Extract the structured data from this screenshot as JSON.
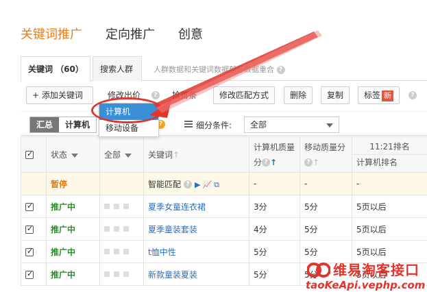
{
  "topnav": [
    "关键词推广",
    "定向推广",
    "创意"
  ],
  "tabs": {
    "keywords": "关键词 （60）",
    "audience": "搜索人群",
    "note": "人群数据和关键词数据部分数据重合"
  },
  "toolbar": {
    "add_keyword": "+ 添加关键词",
    "modify_bid": "修改出价",
    "first_strip": "抢首条",
    "modify_match": "修改匹配方式",
    "delete": "删除",
    "copy": "复制",
    "label": "标签",
    "label_badge": "新"
  },
  "dropdown": {
    "options": [
      "计算机",
      "移动设备"
    ]
  },
  "filterbar": {
    "summary": "汇总",
    "computer": "计算机",
    "detail_label": "细分条件:",
    "detail_value": "全部"
  },
  "table": {
    "headers": {
      "status": "状态",
      "all": "全部",
      "keyword": "关键词",
      "pc_quality": "计算机质量分",
      "mobile_quality": "移动质量分",
      "rank_time": "11:21排名",
      "pc_rank": "计算机排名"
    },
    "rows": [
      {
        "status": "暂停",
        "keyword": "智能匹配",
        "pc": "-",
        "mobile": "-",
        "rank": "-",
        "paused": true
      },
      {
        "status": "推广中",
        "keyword": "夏季女童连衣裙",
        "pc": "3分",
        "mobile": "5分",
        "rank": "5页以后",
        "paused": false
      },
      {
        "status": "推广中",
        "keyword": "夏季童装套装",
        "pc": "4分",
        "mobile": "5分",
        "rank": "5页以后",
        "paused": false
      },
      {
        "status": "推广中",
        "keyword": "t恤中性",
        "pc": "5分",
        "mobile": "5分",
        "rank": "5页以后",
        "paused": false
      },
      {
        "status": "推广中",
        "keyword": "新款童装夏装",
        "pc": "5分",
        "mobile": "5分",
        "rank": "5页以后",
        "paused": false
      }
    ]
  },
  "watermark": {
    "title": "维易淘客接口",
    "url": "taoKeApi.vephp.com"
  },
  "colors": {
    "accent": "#f07a14",
    "selected": "#3b8fd6",
    "annotation": "#e0342c",
    "running": "#2e8b2e"
  }
}
